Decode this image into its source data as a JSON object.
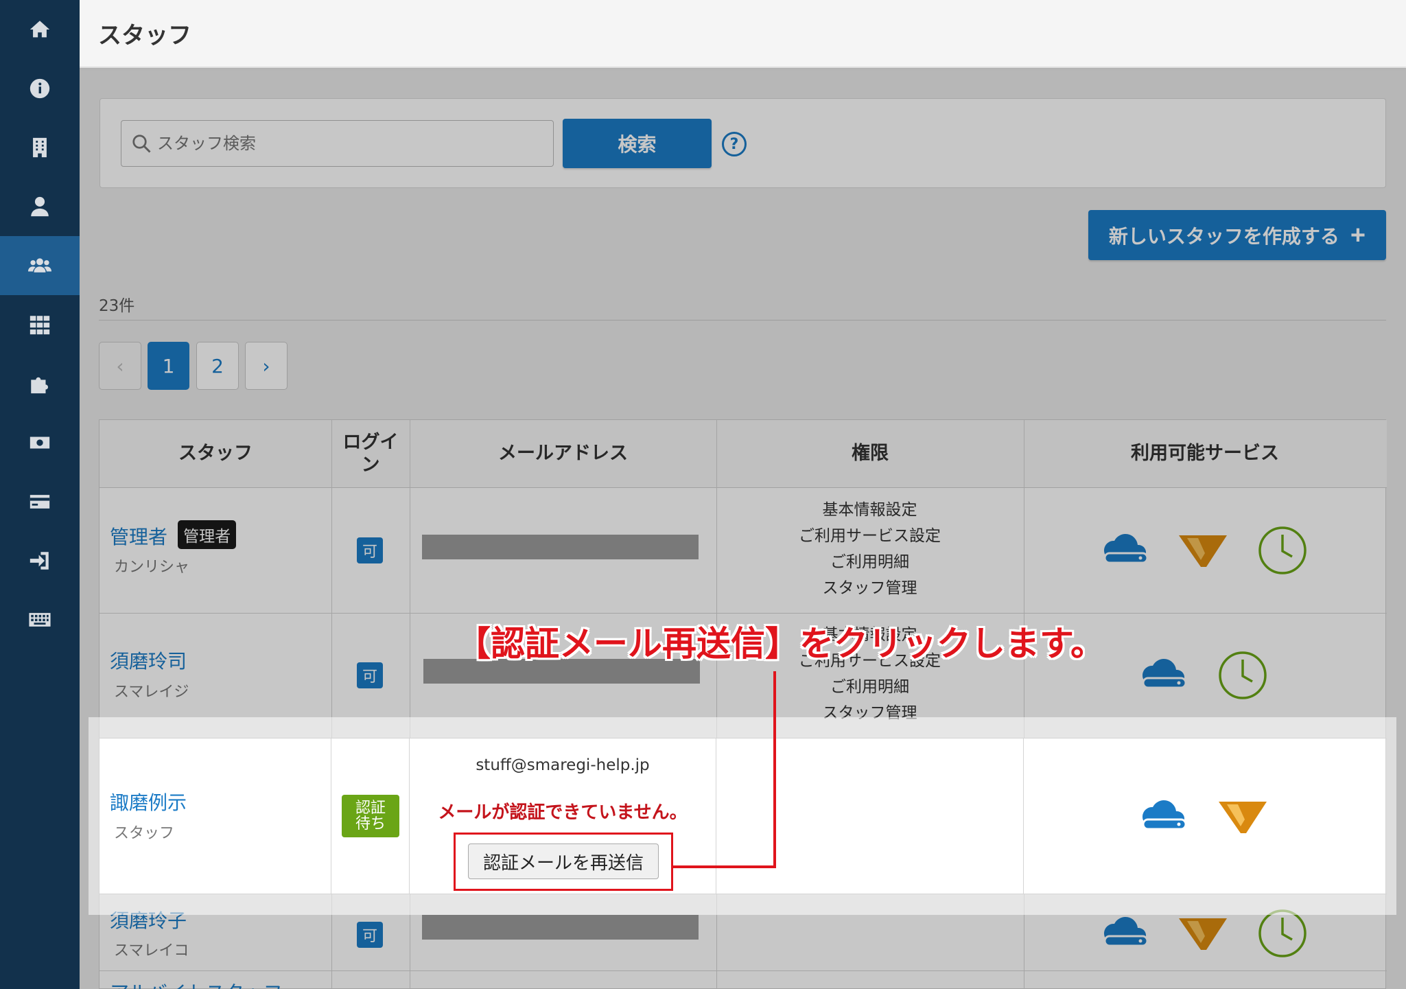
{
  "header": {
    "title": "スタッフ"
  },
  "sidebar": {
    "items": [
      {
        "icon": "home-icon"
      },
      {
        "icon": "info-icon"
      },
      {
        "icon": "building-icon"
      },
      {
        "icon": "user-icon"
      },
      {
        "icon": "users-icon",
        "active": true
      },
      {
        "icon": "apps-grid-icon"
      },
      {
        "icon": "puzzle-icon"
      },
      {
        "icon": "money-icon"
      },
      {
        "icon": "card-icon"
      },
      {
        "icon": "sign-in-icon"
      },
      {
        "icon": "keyboard-icon"
      }
    ]
  },
  "search": {
    "placeholder": "スタッフ検索",
    "button_label": "検索",
    "help": "?"
  },
  "actions": {
    "new_staff_label": "新しいスタッフを作成する"
  },
  "result_count": "23件",
  "pagination": {
    "prev": "‹",
    "pages": [
      "1",
      "2"
    ],
    "current": "1",
    "next": "›"
  },
  "table": {
    "columns": [
      "スタッフ",
      "ログイン",
      "メールアドレス",
      "権限",
      "利用可能サービス"
    ],
    "rows": [
      {
        "name": "管理者",
        "tag": "管理者",
        "kana": "カンリシャ",
        "login": "可",
        "permissions": [
          "基本情報設定",
          "ご利用サービス設定",
          "ご利用明細",
          "スタッフ管理"
        ],
        "services": [
          "cloud",
          "waiter",
          "timecard"
        ]
      },
      {
        "name": "須磨玲司",
        "kana": "スマレイジ",
        "login": "可",
        "permissions": [
          "基本情報設定",
          "ご利用サービス設定",
          "ご利用明細",
          "スタッフ管理"
        ],
        "services": [
          "cloud",
          "timecard"
        ]
      },
      {
        "name": "諏磨例示",
        "kana": "スタッフ",
        "login": "認証待ち",
        "email": "stuff@smaregi-help.jp",
        "warning": "メールが認証できていません。",
        "resend_label": "認証メールを再送信",
        "services": [
          "cloud",
          "waiter"
        ]
      },
      {
        "name": "須磨玲子",
        "kana": "スマレイコ",
        "login": "可",
        "services": [
          "cloud",
          "waiter",
          "timecard"
        ]
      },
      {
        "name": "アルバイトスタッフ"
      }
    ]
  },
  "annotation": {
    "callout": "【認証メール再送信】をクリックします。"
  },
  "colors": {
    "sidebar": "#12314c",
    "accent": "#1b7bc6",
    "pending": "#6aa516",
    "alert": "#e0141c"
  }
}
